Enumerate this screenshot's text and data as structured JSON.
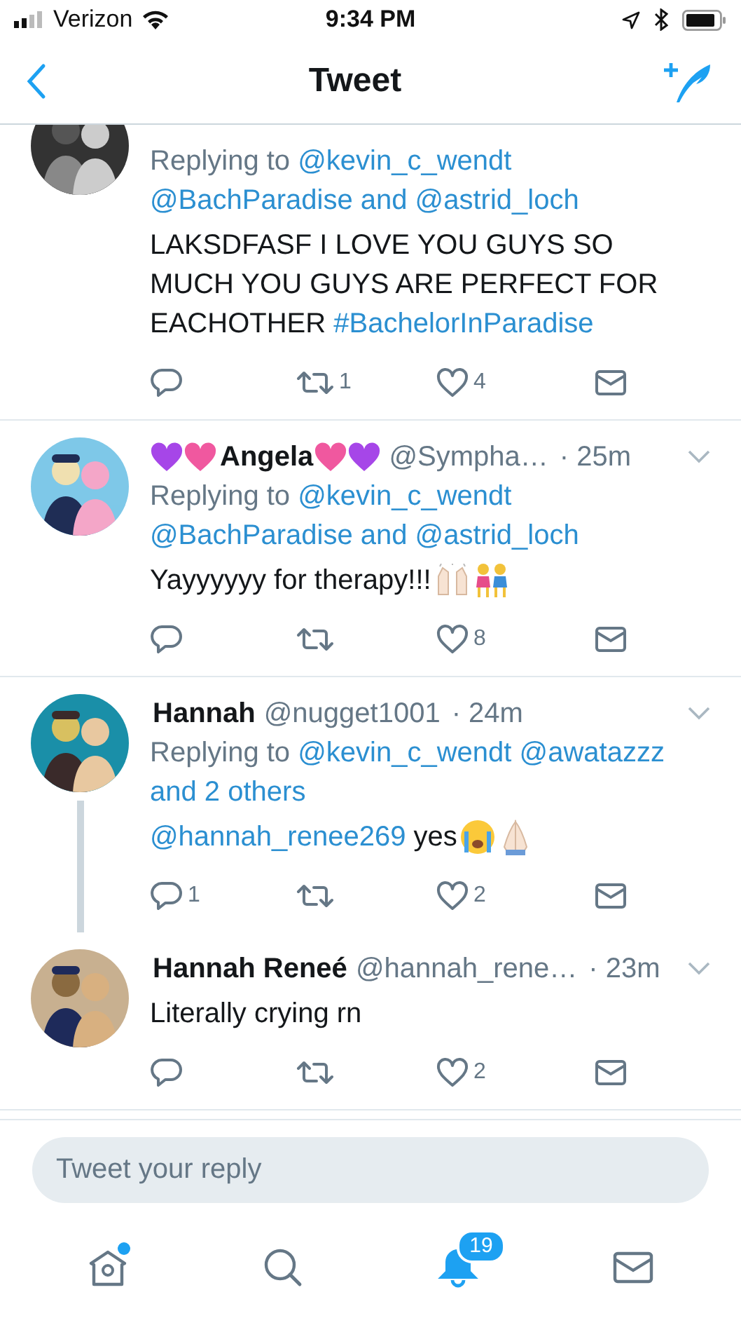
{
  "status_bar": {
    "carrier": "Verizon",
    "time": "9:34 PM"
  },
  "nav": {
    "title": "Tweet"
  },
  "tweets": [
    {
      "replying_prefix": "Replying to",
      "replying_to": "@kevin_c_wendt @BachParadise and @astrid_loch",
      "text": [
        {
          "kind": "plain",
          "text": "LAKSDFASF I LOVE YOU GUYS SO MUCH YOU GUYS ARE PERFECT FOR EACHOTHER "
        },
        {
          "kind": "link",
          "text": "#BachelorInParadise"
        }
      ],
      "actions": {
        "retweets": "1",
        "likes": "4"
      },
      "thread_continues": false
    },
    {
      "name_hearts_before": [
        {
          "color": "#a646e8"
        },
        {
          "color": "#f0589f"
        }
      ],
      "name": "Angela",
      "name_hearts_after": [
        {
          "color": "#f0589f"
        },
        {
          "color": "#a646e8"
        }
      ],
      "handle": "@Sympha…",
      "time": "· 25m",
      "replying_prefix": "Replying to",
      "replying_to": "@kevin_c_wendt @BachParadise and @astrid_loch",
      "text": [
        {
          "kind": "plain",
          "text": "Yayyyyyy for therapy!!!"
        }
      ],
      "emoji": [
        {
          "kind": "raised-hands"
        },
        {
          "kind": "two-women"
        }
      ],
      "actions": {
        "likes": "8"
      },
      "thread_continues": false
    },
    {
      "name": "Hannah",
      "handle": "@nugget1001",
      "time": "· 24m",
      "replying_prefix": "Replying to",
      "replying_to": "@kevin_c_wendt @awatazzz and 2 others",
      "text": [
        {
          "kind": "link",
          "text": "@hannah_renee269"
        },
        {
          "kind": "plain",
          "text": " yes"
        }
      ],
      "emoji": [
        {
          "kind": "crying-face"
        },
        {
          "kind": "praying-hands"
        }
      ],
      "actions": {
        "replies": "1",
        "likes": "2"
      },
      "thread_continues": true
    },
    {
      "name": "Hannah Reneé",
      "handle": "@hannah_rene…",
      "time": "· 23m",
      "text": [
        {
          "kind": "plain",
          "text": "Literally crying rn"
        }
      ],
      "actions": {
        "likes": "2"
      },
      "thread_continues": false
    }
  ],
  "reply": {
    "placeholder": "Tweet your reply"
  },
  "tabs": [
    {
      "kind": "home",
      "selected": false,
      "new_dot": true
    },
    {
      "kind": "search",
      "selected": false,
      "new_dot": false
    },
    {
      "kind": "notifications",
      "selected": true,
      "new_dot": false,
      "badge": "19"
    },
    {
      "kind": "messages",
      "selected": false,
      "new_dot": false
    }
  ]
}
